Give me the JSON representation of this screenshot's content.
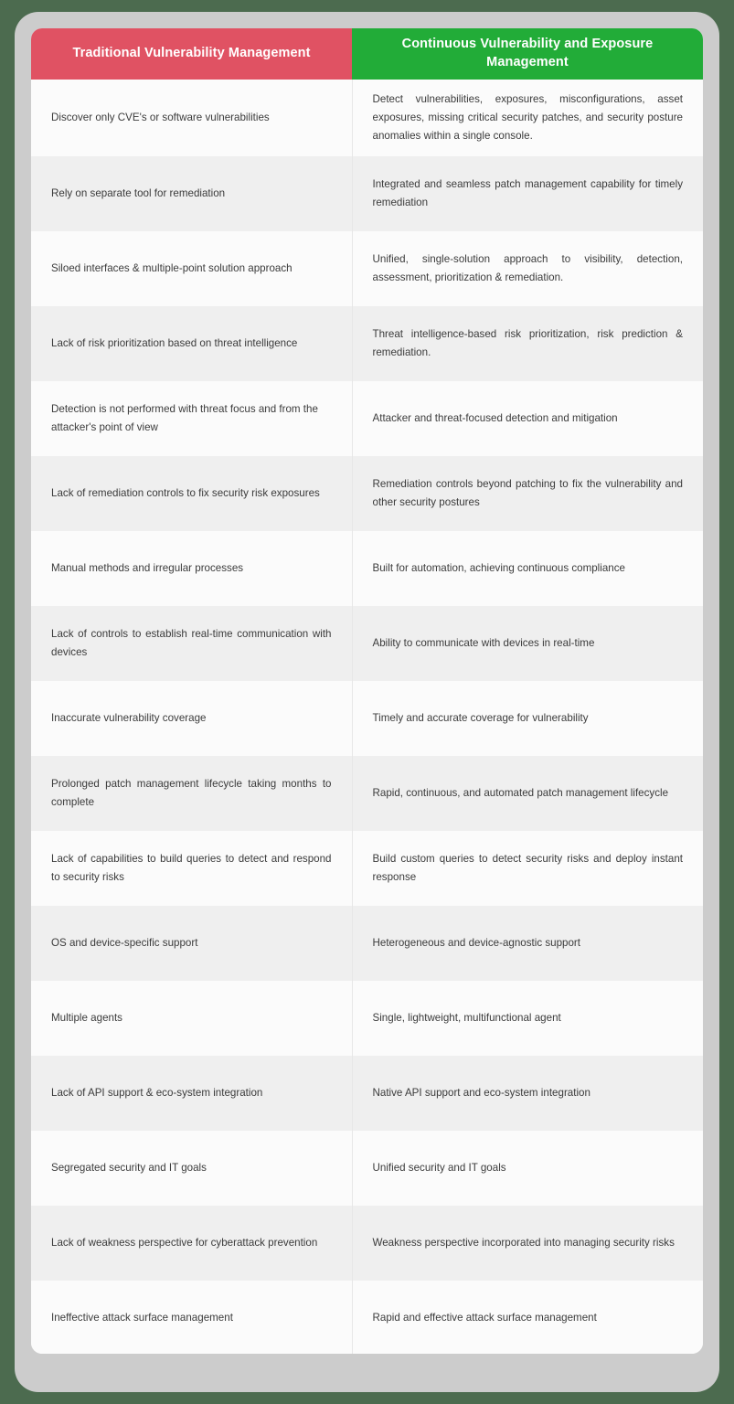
{
  "document": {
    "type": "comparison-table",
    "title": "Traditional Vulnerability Management vs Continuous Vulnerability and Exposure Management"
  },
  "colors": {
    "header_left_bg": "#e05263",
    "header_right_bg": "#22ac38",
    "header_text": "#ffffff",
    "row_odd_bg": "#fbfbfb",
    "row_even_bg": "#efefef",
    "body_text": "#3b3b3b",
    "frame_bg": "#cccccc",
    "page_bg": "#4c6b4f",
    "cell_divider": "#e7e7e7"
  },
  "table": {
    "headers": {
      "left": "Traditional Vulnerability Management",
      "right": "Continuous Vulnerability and Exposure Management"
    },
    "rows": [
      {
        "left": "Discover only CVE's or software vulnerabilities",
        "right": "Detect vulnerabilities, exposures, misconfigurations, asset exposures, missing critical security patches, and security posture anomalies within a single console.",
        "left_justify": false,
        "right_justify": true
      },
      {
        "left": "Rely on separate tool for remediation",
        "right": "Integrated and seamless patch management capability for timely remediation",
        "left_justify": false,
        "right_justify": true
      },
      {
        "left": "Siloed interfaces & multiple-point solution approach",
        "right": "Unified, single-solution approach to visibility, detection, assessment, prioritization & remediation.",
        "left_justify": false,
        "right_justify": true
      },
      {
        "left": "Lack of risk prioritization based on threat intelligence",
        "right": "Threat intelligence-based risk prioritization, risk prediction & remediation.",
        "left_justify": false,
        "right_justify": true
      },
      {
        "left": "Detection is not performed with threat focus and from the attacker's point of view",
        "right": "Attacker and threat-focused detection and mitigation",
        "left_justify": false,
        "right_justify": true
      },
      {
        "left": "Lack of remediation controls to fix security risk exposures",
        "right": "Remediation controls beyond patching to fix the vulnerability and other security postures",
        "left_justify": true,
        "right_justify": true
      },
      {
        "left": "Manual methods and irregular processes",
        "right": "Built for automation, achieving continuous compliance",
        "left_justify": false,
        "right_justify": true
      },
      {
        "left": "Lack of controls to establish real-time communication with devices",
        "right": "Ability to communicate with devices in real-time",
        "left_justify": true,
        "right_justify": false
      },
      {
        "left": "Inaccurate vulnerability coverage",
        "right": "Timely and accurate coverage for vulnerability",
        "left_justify": false,
        "right_justify": false
      },
      {
        "left": "Prolonged patch management lifecycle taking months to complete",
        "right": "Rapid, continuous, and automated patch management lifecycle",
        "left_justify": true,
        "right_justify": true
      },
      {
        "left": "Lack of capabilities to build queries to detect and respond to security risks",
        "right": "Build custom queries to detect security risks and deploy instant response",
        "left_justify": true,
        "right_justify": true
      },
      {
        "left": "OS and device-specific support",
        "right": "Heterogeneous and device-agnostic support",
        "left_justify": false,
        "right_justify": false
      },
      {
        "left": "Multiple agents",
        "right": "Single, lightweight, multifunctional agent",
        "left_justify": false,
        "right_justify": false
      },
      {
        "left": "Lack of API support & eco-system integration",
        "right": "Native API support and eco-system integration",
        "left_justify": false,
        "right_justify": false
      },
      {
        "left": "Segregated security and IT goals",
        "right": "Unified security and IT goals",
        "left_justify": false,
        "right_justify": false
      },
      {
        "left": "Lack of weakness perspective for cyberattack prevention",
        "right": "Weakness perspective incorporated into managing security risks",
        "left_justify": true,
        "right_justify": true
      },
      {
        "left": "Ineffective attack surface management",
        "right": "Rapid and effective attack surface management",
        "left_justify": false,
        "right_justify": false
      }
    ]
  }
}
